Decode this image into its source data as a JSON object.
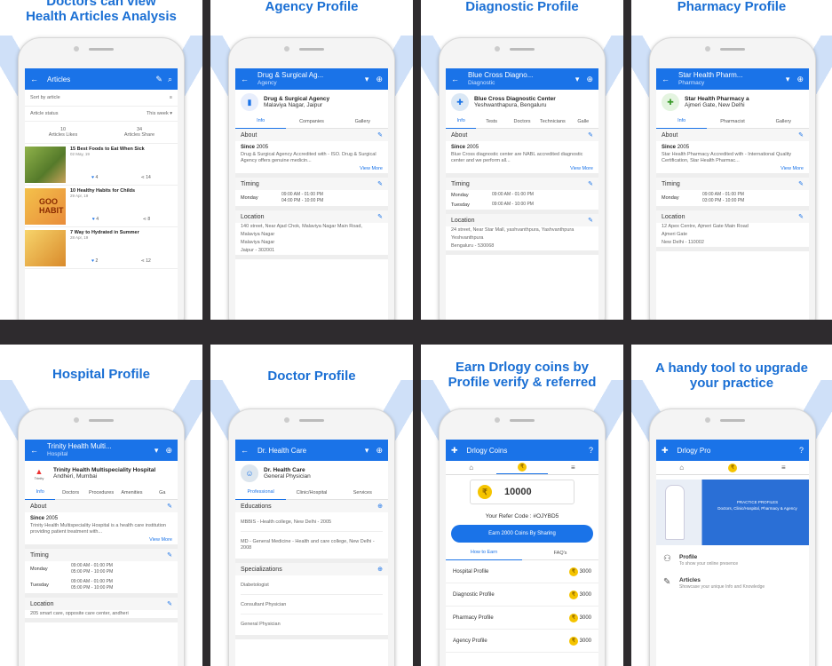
{
  "captions": {
    "p1a": "Doctors can view",
    "p1b": "Health Articles Analysis",
    "p2": "Agency Profile",
    "p3": "Diagnostic Profile",
    "p4": "Pharmacy Profile",
    "p5": "Hospital Profile",
    "p6": "Doctor Profile",
    "p7a": "Earn Drlogy coins by",
    "p7b": "Profile verify & referred",
    "p8a": "A handy tool to upgrade",
    "p8b": "your practice"
  },
  "articles": {
    "title": "Articles",
    "sort": "Sort by article",
    "status": "Article status",
    "week": "This week",
    "likes_n": "10",
    "likes": "Articles Likes",
    "share_n": "34",
    "share": "Articles Share",
    "items": [
      {
        "title": "15 Best Foods to Eat When Sick",
        "date": "02 May, 19",
        "likes": "4",
        "shares": "14"
      },
      {
        "title": "10 Healthy Habits for Childs",
        "date": "29 Apr, 19",
        "likes": "4",
        "shares": "8"
      },
      {
        "title": "7 Way to Hydrated in Summer",
        "date": "28 Apr, 19",
        "likes": "2",
        "shares": "12"
      }
    ],
    "img2": "GOO HABIT"
  },
  "agency": {
    "title": "Drug & Surgical Ag...",
    "sub": "Agency",
    "name": "Drug & Surgical Agency",
    "addr": "Malaviya Nagar, Jaipur",
    "tabs": [
      "Info",
      "Companies",
      "Gallery"
    ],
    "about": "About",
    "since": "Since",
    "year": "2005",
    "desc": "Drug & Surgical Agency Accredited with - ISO. Drug & Surgical Agency offers genuine medicin...",
    "viewmore": "View More",
    "timing": "Timing",
    "day": "Monday",
    "t1": "09:00 AM - 01:00 PM",
    "t2": "04:00 PM - 10:00 PM",
    "location": "Location",
    "l1": "140 street, Near Ajad Chok, Malaviya Nagar Main Road, Malaviya Nagar",
    "l2": "Malaviya Nagar",
    "l3": "Jaipur - 302001"
  },
  "diag": {
    "title": "Blue Cross Diagno...",
    "sub": "Diagnostic",
    "name": "Blue Cross Diagnostic Center",
    "addr": "Yeshwanthapura, Bengaluru",
    "tabs": [
      "Info",
      "Tests",
      "Doctors",
      "Technicians",
      "Galle"
    ],
    "about": "About",
    "since": "Since",
    "year": "2005",
    "desc": "Blue Cross diagnostic center are NABL accredited diagnostic center and we perform all...",
    "viewmore": "View More",
    "timing": "Timing",
    "d1": "Monday",
    "d2": "Tuesday",
    "t1": "09:00 AM - 01:00 PM",
    "t2": "09:00 AM - 10:00 PM",
    "location": "Location",
    "l1": "24 street, Near Star Mall, yashvanthpura, Yashvanthpura",
    "l2": "Yeshvanthpura",
    "l3": "Bengaluru - 530068"
  },
  "pharm": {
    "title": "Star Health Pharm...",
    "sub": "Pharmacy",
    "name": "Star Health Pharmacy a",
    "addr": "Ajmeri Gate, New Delhi",
    "tabs": [
      "Info",
      "Pharmacist",
      "Gallery"
    ],
    "about": "About",
    "since": "Since",
    "year": "2005",
    "desc": "Star Health Pharmacy Accredited with - International Quality Certification, Star Health Pharmac...",
    "viewmore": "View More",
    "timing": "Timing",
    "day": "Monday",
    "t1": "09:00 AM - 01:00 PM",
    "t2": "03:00 PM - 10:00 PM",
    "location": "Location",
    "l1": "12 Apex Centre, Ajmeri Gate Main Road",
    "l2": "Ajmeri Gate",
    "l3": "New Delhi - 110002"
  },
  "hosp": {
    "title": "Trinity Health Multi...",
    "sub": "Hospital",
    "name": "Trinity Health Multispeciality Hospital",
    "addr": "Andheri, Mumbai",
    "logo": "Trinity",
    "tabs": [
      "Info",
      "Doctors",
      "Procedures",
      "Amenities",
      "Ga"
    ],
    "about": "About",
    "since": "Since",
    "year": "2005",
    "desc": "Trinity Health Multispeciality Hospital is a health care institution providing patient treatment with...",
    "viewmore": "View More",
    "timing": "Timing",
    "d1": "Monday",
    "d2": "Tuesday",
    "t1": "09:00 AM - 01:00 PM",
    "t2": "05:00 PM - 10:00 PM",
    "location": "Location",
    "l1": "205 smart care, opposite care center, andheri"
  },
  "doctor": {
    "title": "Dr. Health Care",
    "name": "Dr. Health Care",
    "spec": "General Physician",
    "tabs": [
      "Professional",
      "Clinic/Hospital",
      "Services"
    ],
    "edu": "Educations",
    "e1": "MBBIS - Health college, New Delhi - 2005",
    "e2": "MD - General Medicine - Health and care college, New Delhi - 2008",
    "specs": "Specializations",
    "s1": "Diabetologist",
    "s2": "Consultant Physician",
    "s3": "General Physician"
  },
  "coins": {
    "title": "Drlogy Coins",
    "amount": "10000",
    "refer": "Your Refer Code : #OJYBD5",
    "btn": "Earn 2000 Coins By Sharing",
    "tabs": [
      "How to Earn",
      "FAQ's"
    ],
    "rows": [
      {
        "label": "Hospital Profile",
        "val": "3000"
      },
      {
        "label": "Diagnostic Profile",
        "val": "3000"
      },
      {
        "label": "Pharmacy Profile",
        "val": "3000"
      },
      {
        "label": "Agency Profile",
        "val": "3000"
      }
    ]
  },
  "pro": {
    "title": "Drlogy Pro",
    "banner1": "PRACTICE PROFILES",
    "banner2": "Doctors, Clinic/Hospital, Pharmacy & Agency",
    "i1": "Profile",
    "i1s": "To show your online presence",
    "i2": "Articles",
    "i2s": "Showcase your unique Info and Knowledge"
  },
  "colors": {
    "accent": "#1a73e8",
    "bg": "#2e2b2e"
  }
}
